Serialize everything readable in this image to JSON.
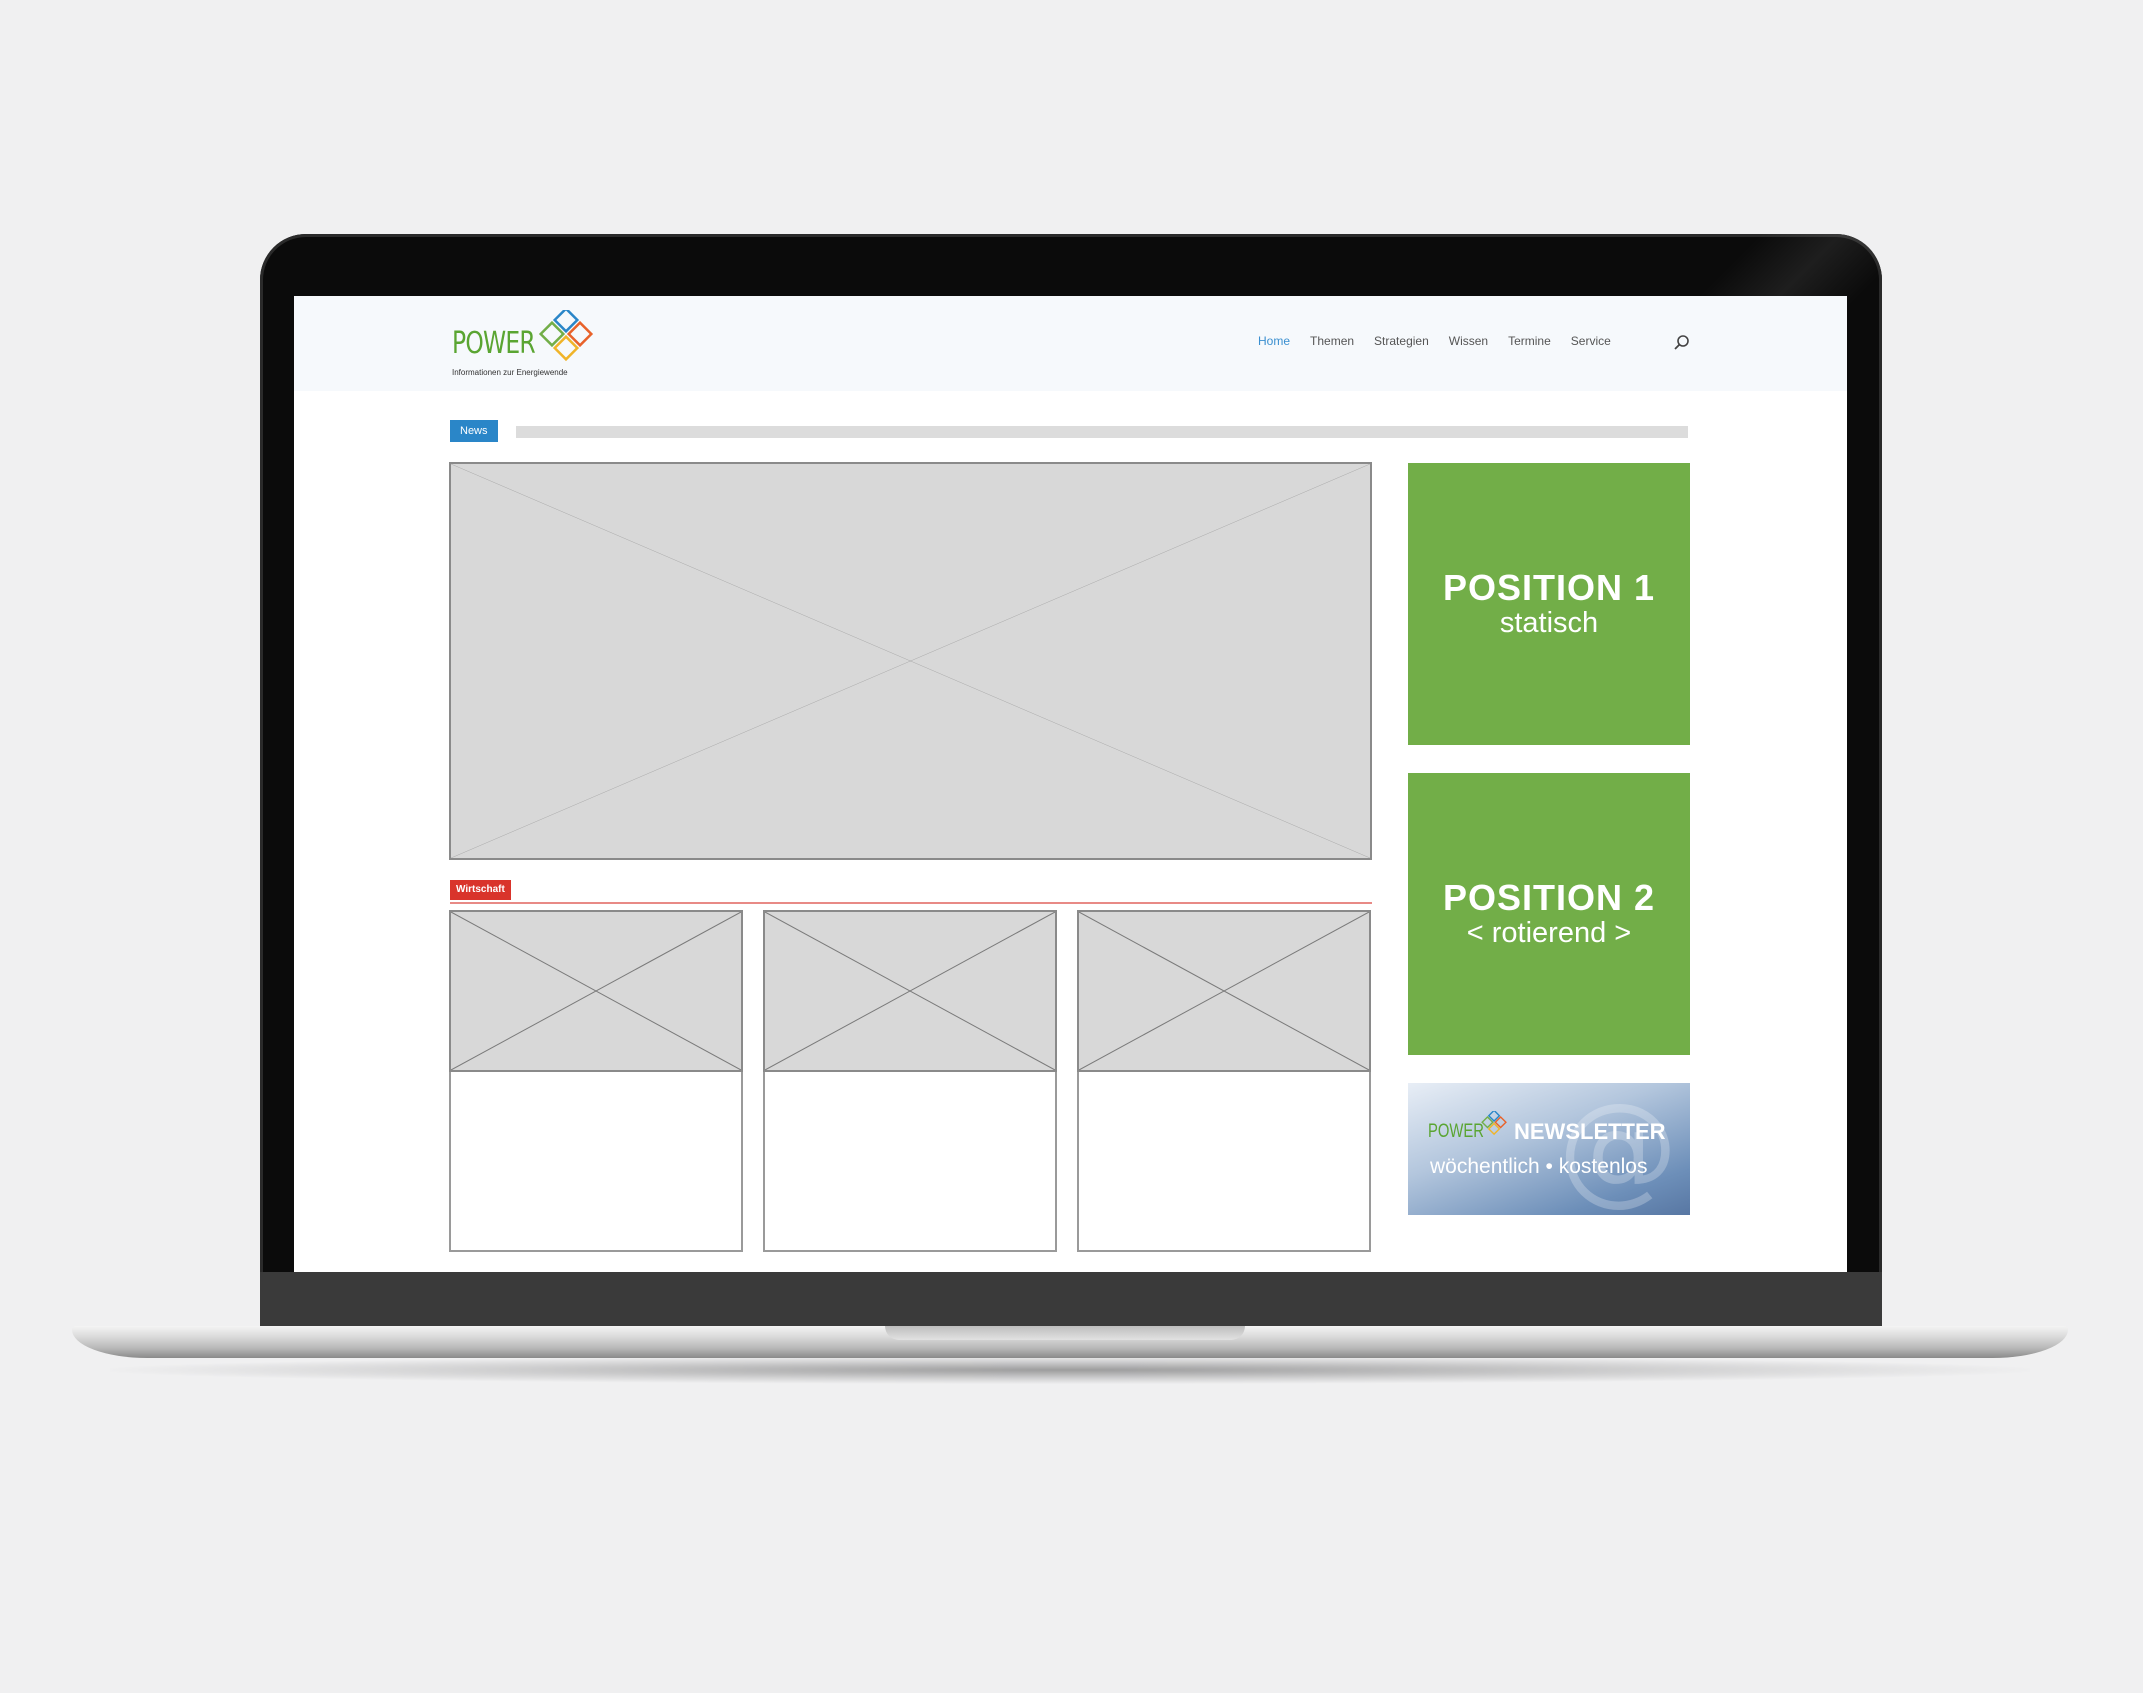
{
  "site": {
    "logo_word": "POWER",
    "logo_tagline": "Informationen zur Energiewende"
  },
  "nav": {
    "items": [
      {
        "label": "Home",
        "active": true
      },
      {
        "label": "Themen"
      },
      {
        "label": "Strategien"
      },
      {
        "label": "Wissen"
      },
      {
        "label": "Termine"
      },
      {
        "label": "Service"
      }
    ],
    "search_icon": "search-icon"
  },
  "sections": {
    "news_tag": "News",
    "wirtschaft_tag": "Wirtschaft"
  },
  "ads": {
    "position1": {
      "title": "POSITION 1",
      "subtitle": "statisch"
    },
    "position2": {
      "title": "POSITION 2",
      "subtitle": "< rotierend >"
    }
  },
  "newsletter": {
    "brand": "POWER",
    "title": "NEWSLETTER",
    "subtitle": "wöchentlich • kostenlos"
  },
  "colors": {
    "accent_blue": "#2a86c8",
    "accent_red": "#d9342b",
    "ad_green": "#72ae48",
    "logo_green": "#5aa532"
  }
}
